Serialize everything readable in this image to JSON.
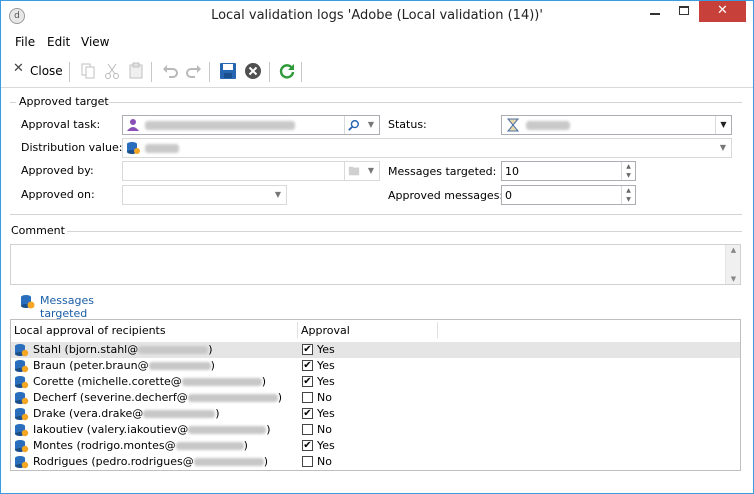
{
  "window": {
    "title": "Local validation logs 'Adobe (Local validation (14))'",
    "app_icon": "d"
  },
  "menu": {
    "file": "File",
    "edit": "Edit",
    "view": "View"
  },
  "toolbar": {
    "close_label": "Close"
  },
  "approved_target": {
    "group_label": "Approved target",
    "approval_task_label": "Approval task:",
    "distribution_value_label": "Distribution value:",
    "approved_by_label": "Approved by:",
    "approved_on_label": "Approved on:",
    "status_label": "Status:",
    "messages_targeted_label": "Messages targeted:",
    "messages_targeted_value": "10",
    "approved_messages_label": "Approved messages:",
    "approved_messages_value": "0"
  },
  "comment": {
    "label": "Comment"
  },
  "links": {
    "messages_targeted": "Messages targeted"
  },
  "table": {
    "col_recipient": "Local approval of recipients",
    "col_approval": "Approval",
    "rows": [
      {
        "name": "Stahl (bjorn.stahl@",
        "suffix": ")",
        "approved": true,
        "approval": "Yes"
      },
      {
        "name": "Braun (peter.braun@",
        "suffix": ")",
        "approved": true,
        "approval": "Yes"
      },
      {
        "name": "Corette (michelle.corette@",
        "suffix": ")",
        "approved": true,
        "approval": "Yes"
      },
      {
        "name": "Decherf (severine.decherf@",
        "suffix": ")",
        "approved": false,
        "approval": "No"
      },
      {
        "name": "Drake (vera.drake@",
        "suffix": ")",
        "approved": true,
        "approval": "Yes"
      },
      {
        "name": "Iakoutiev (valery.iakoutiev@",
        "suffix": ")",
        "approved": false,
        "approval": "No"
      },
      {
        "name": "Montes (rodrigo.montes@",
        "suffix": ")",
        "approved": true,
        "approval": "Yes"
      },
      {
        "name": "Rodrigues (pedro.rodrigues@",
        "suffix": ")",
        "approved": false,
        "approval": "No"
      }
    ]
  },
  "colors": {
    "accent": "#3c9be0",
    "link": "#1a5ea8",
    "close_button": "#c8403a"
  }
}
